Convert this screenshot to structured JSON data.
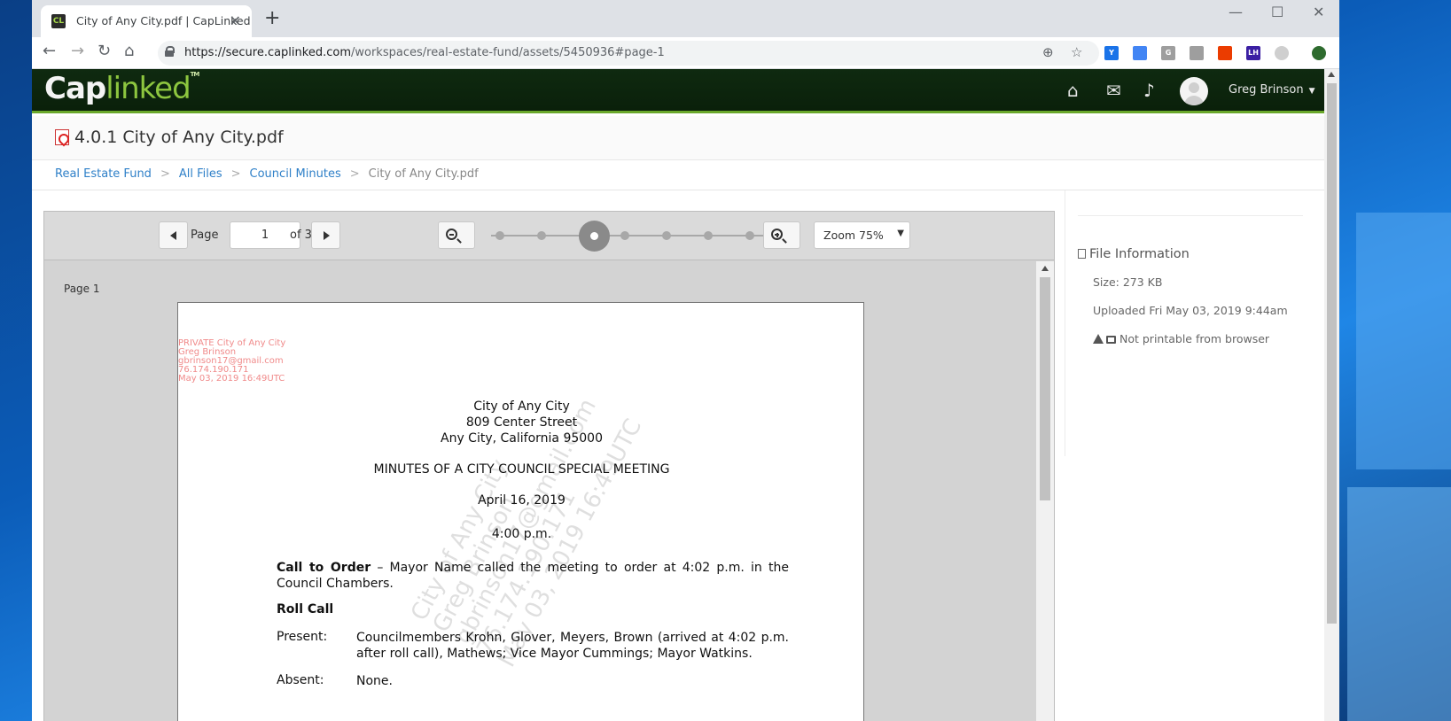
{
  "browser": {
    "tab_title": "City of Any City.pdf | CapLinked",
    "tab_favicon": "CL",
    "url_host": "https://secure.caplinked.com",
    "url_path": "/workspaces/real-estate-fund/assets/5450936#page-1",
    "extensions": [
      "Y",
      "",
      "G",
      "",
      "",
      "LH",
      "",
      "",
      ""
    ]
  },
  "header": {
    "logo_cap": "Cap",
    "logo_linked": "linked",
    "logo_tm": "TM",
    "user_name": "Greg Brinson",
    "caret": "▼"
  },
  "document": {
    "title": "4.0.1 City of Any City.pdf"
  },
  "breadcrumb": {
    "items": [
      "Real Estate Fund",
      "All Files",
      "Council Minutes"
    ],
    "current": "City of Any City.pdf",
    "separator": ">"
  },
  "viewer": {
    "page_label": "Page",
    "page_value": "1",
    "of_label": "of 3",
    "zoom_label": "Zoom 75%",
    "zoom_fraction": 0.333,
    "page_caption": "Page 1"
  },
  "pdf": {
    "watermark_lines": [
      "PRIVATE City of Any City",
      "Greg Brinson",
      "gbrinson17@gmail.com",
      "76.174.190.171",
      "May 03, 2019 16:49UTC"
    ],
    "heading_lines": [
      "City of Any City",
      "809 Center Street",
      "Any City, California  95000"
    ],
    "meeting_title": "MINUTES OF A CITY COUNCIL SPECIAL MEETING",
    "date": "April 16, 2019",
    "time": "4:00 p.m.",
    "call_to_order_label": "Call to Order",
    "call_to_order_text": " – Mayor Name called the meeting to order at 4:02 p.m. in the Council Chambers.",
    "roll_call_label": "Roll Call",
    "present_label": "Present:",
    "present_text": "Councilmembers Krohn, Glover, Meyers, Brown (arrived at 4:02 p.m. after roll call), Mathews; Vice Mayor Cummings; Mayor Watkins.",
    "absent_label": "Absent:",
    "absent_text": "None.",
    "diagonal_watermark": [
      "City of Any City",
      "Greg Brinson",
      "gbrinson17@gmail.com",
      "76.174.190.171",
      "May 03, 2019 16:49UTC"
    ]
  },
  "sidebar": {
    "title": "File Information",
    "size": "Size: 273 KB",
    "uploaded": "Uploaded Fri May 03, 2019 9:44am",
    "printable": "Not printable from browser"
  }
}
